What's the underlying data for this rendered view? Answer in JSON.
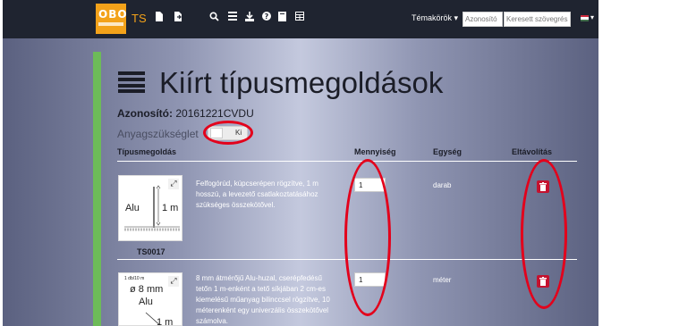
{
  "navbar": {
    "logo_text": "OBO",
    "brand": "TS",
    "icons": [
      "file-icon",
      "file-arrow-icon",
      "search-icon",
      "list-icon",
      "download-icon",
      "help-icon",
      "book-icon",
      "table-icon"
    ],
    "menu_label": "Témakörök",
    "id_placeholder": "Azonosító",
    "search_placeholder": "Keresett szövegrész",
    "flag_colors": [
      "#cd2a3e",
      "#ffffff",
      "#436f4d"
    ]
  },
  "page": {
    "title": "Kiírt típusmegoldások",
    "id_label": "Azonosító:",
    "id_value": "20161221CVDU",
    "material_label": "Anyagszükséglet",
    "toggle_label": "Ki"
  },
  "table": {
    "headers": {
      "solution": "Típusmegoldás",
      "quantity": "Mennyiség",
      "unit": "Egység",
      "remove": "Eltávolítás"
    },
    "rows": [
      {
        "code": "TS0017",
        "thumb_text": "Alu",
        "thumb_dim": "1 m",
        "description": "Felfogórúd, kúpcserépen rögzítve, 1 m hosszú, a levezető csatlakoztatásához szükséges összekötővel.",
        "quantity": "1",
        "unit": "darab"
      },
      {
        "code": "",
        "thumb_small": "1 db/10 m",
        "thumb_dia": "ø 8 mm",
        "thumb_text": "Alu",
        "thumb_dim": "1 m",
        "description": "8 mm átmérőjű Alu-huzal, cserépfedésű tetőn 1 m-enként a tető síkjában 2 cm-es kiemelésű műanyag bilinccsel rögzítve, 10 méterenként egy univerzális összekötővel számolva.",
        "quantity": "1",
        "unit": "méter"
      }
    ]
  },
  "colors": {
    "accent": "#f3a21a",
    "navbar": "#1f2430",
    "green_bar": "#6dbb58",
    "delete": "#c4122f",
    "annotation": "#e3001b"
  }
}
